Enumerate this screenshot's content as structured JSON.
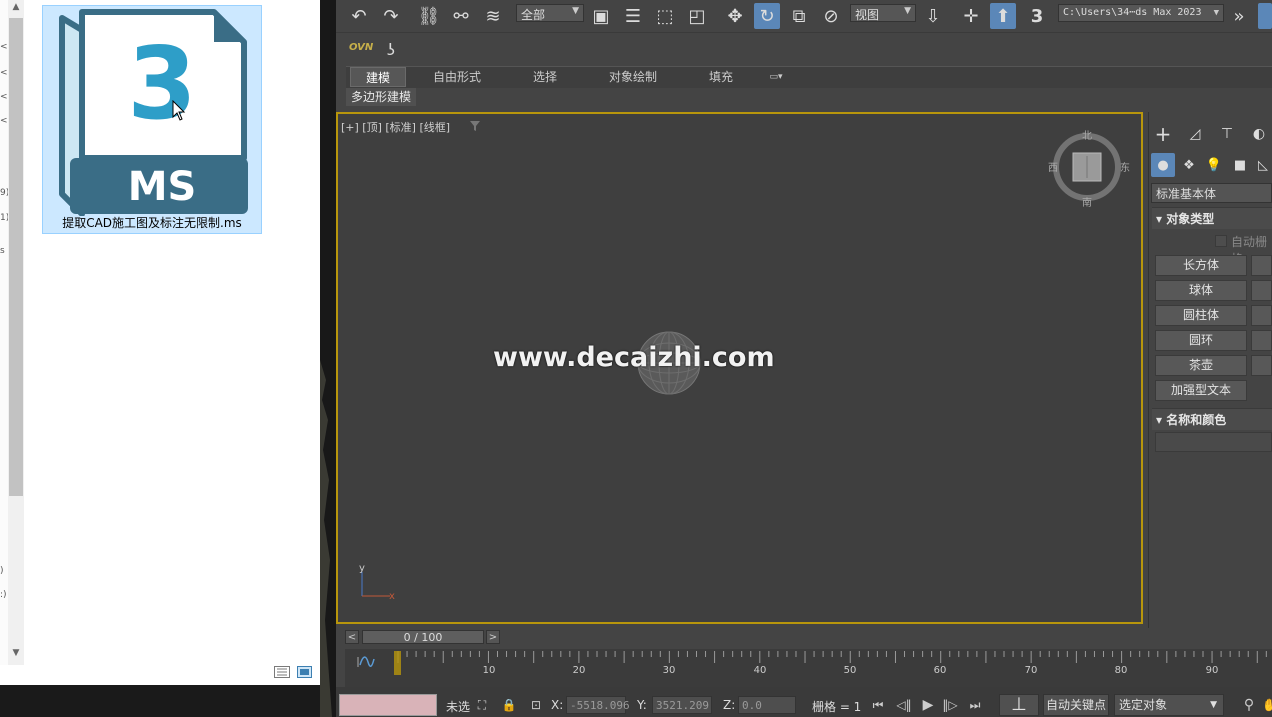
{
  "explorer": {
    "file_name": "提取CAD施工图及标注无限制.ms",
    "icon_number": "3",
    "icon_ext": "MS",
    "strip_glyphs": [
      "<",
      "<",
      "<",
      "<",
      "9)",
      "1)",
      "s",
      ")",
      ":)"
    ]
  },
  "toolbar": {
    "selection_filter": "全部",
    "ref_coord": "视图",
    "project_path": "C:\\Users\\34⋯ds Max 2023"
  },
  "row2": {
    "ovn": "OVN"
  },
  "ribbon": {
    "tabs": [
      "建模",
      "自由形式",
      "选择",
      "对象绘制",
      "填充"
    ],
    "sub_label": "多边形建模"
  },
  "viewport": {
    "label": "[+] [顶] [标准] [线框]",
    "watermark": "www.decaizhi.com",
    "compass": {
      "north": "北",
      "south": "南",
      "east": "东",
      "west": "西"
    },
    "axis_y": "y",
    "axis_x": "x"
  },
  "command_panel": {
    "category": "标准基本体",
    "object_type_title": "对象类型",
    "autogrid": "自动栅格",
    "buttons": [
      "长方体",
      "球体",
      "圆柱体",
      "圆环",
      "茶壶",
      "加强型文本"
    ],
    "name_color_title": "名称和颜色"
  },
  "timeline": {
    "frame_display": "0 / 100",
    "ticks": [
      "10",
      "20",
      "30",
      "40",
      "50",
      "60",
      "70",
      "80",
      "90"
    ]
  },
  "status": {
    "unselected": "未选",
    "x_label": "X:",
    "x_value": "-5518.096",
    "y_label": "Y:",
    "y_value": "3521.209",
    "z_label": "Z:",
    "z_value": "0.0",
    "grid": "栅格 = 1",
    "auto_key": "自动关键点",
    "selected_objects": "选定对象"
  },
  "colors": {
    "viewport_border": "#b8960c",
    "active_blue": "#5b87b8",
    "maxscript_box": "#d9b3b8",
    "ms_blue": "#2e9ec8",
    "ms_dark": "#3a6d86"
  }
}
